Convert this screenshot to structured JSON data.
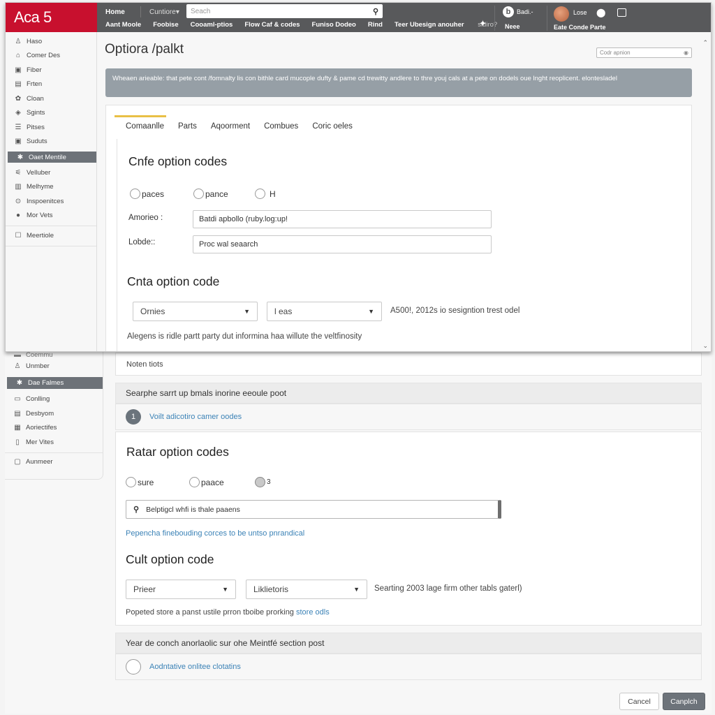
{
  "app": {
    "brand": "Aca 5",
    "brand_color": "#c8102e",
    "header_color": "#58595b"
  },
  "topnav": {
    "home": "Home",
    "customize": "Cuntiore",
    "search_placeholder": "Seach",
    "items": [
      "Aant Moole",
      "Foobise",
      "Cooaml-ptios",
      "Flow Caf & codes",
      "Funiso Dodeo",
      "Rind"
    ],
    "extra_text": "Teer Ubesign anouher",
    "extra_muted": "sidiro?",
    "user1": {
      "label": "Badi.-",
      "sub": "Neee"
    },
    "user2": {
      "label": "Lose",
      "sub": "Eate Conde Parte"
    }
  },
  "sidebar_top": {
    "items": [
      {
        "icon": "person-icon",
        "glyph": "♙",
        "label": "Haso"
      },
      {
        "icon": "building-icon",
        "glyph": "⌂",
        "label": "Comer Des"
      },
      {
        "icon": "inbox-icon",
        "glyph": "▣",
        "label": "Fiber"
      },
      {
        "icon": "document-icon",
        "glyph": "▤",
        "label": "Frten"
      },
      {
        "icon": "gear-icon",
        "glyph": "✿",
        "label": "Cloan"
      },
      {
        "icon": "tag-icon",
        "glyph": "◈",
        "label": "Sgints"
      },
      {
        "icon": "list-icon",
        "glyph": "☰",
        "label": "Pitses"
      },
      {
        "icon": "lock-icon",
        "glyph": "🔒",
        "label": "Suduts"
      }
    ],
    "active": {
      "icon": "badge-icon",
      "glyph": "✱",
      "label": "Oaet Mentile"
    },
    "items2": [
      {
        "icon": "filter-icon",
        "glyph": "⚟",
        "label": "Velluber"
      },
      {
        "icon": "chart-icon",
        "glyph": "▥",
        "label": "Melhyme"
      },
      {
        "icon": "info-icon",
        "glyph": "⊙",
        "label": "Inspoenitces"
      },
      {
        "icon": "pin-icon",
        "glyph": "●",
        "label": "Mor Vets"
      }
    ],
    "footer": {
      "icon": "checkbox-icon",
      "glyph": "☐",
      "label": "Meertiole"
    }
  },
  "page": {
    "title": "Optiora /palkt",
    "code_option_placeholder": "Codr apnion",
    "banner": "Wheaen arieable: that pete cont /fomnalty lis con bithle card mucople dufty & pame cd trewitty andlere to thre youj cals at a pete on dodels oue lnght reoplicent. elontesladel",
    "tabs": [
      "Comaanlle",
      "Parts",
      "Aqoorment",
      "Combues",
      "Coric oeles"
    ],
    "active_tab": 0
  },
  "section1": {
    "title": "Cnfe option codes",
    "radios": [
      "paces",
      "pance",
      "H"
    ],
    "fields": [
      {
        "label": "Amorieo :",
        "value": "Batdi apbollo (ruby.log:up!"
      },
      {
        "label": "Lobde::",
        "value": "Proc wal seaarch"
      }
    ]
  },
  "section2": {
    "title": "Cnta option code",
    "select1": "Ornies",
    "select2": "l eas",
    "info": "A500!, 2012s io sesigntion trest odel",
    "note": "Alegens is ridle partt party dut informina haa willute the veltfinosity"
  },
  "lower": {
    "notes_title": "Noten tiots",
    "panel1": {
      "header": "Searphe sarrt up bmals inorine eeoule poot",
      "step_number": "1",
      "link": "Voilt adicotiro camer oodes"
    },
    "section3": {
      "title": "Ratar option codes",
      "radios": [
        "sure",
        "paace",
        "3"
      ],
      "selected_radio": 2,
      "search_value": "Belptigcl whfi is thale paaens",
      "link_text": "Pepencha finebouding corces to be untso pnrandical"
    },
    "section4": {
      "title": "Cult option code",
      "select1": "Prieer",
      "select2": "Liklietoris",
      "info": "Searting 2003 lage firm other tabls gaterl)",
      "note": "Popeted store a panst ustile prron tboibe prorking",
      "note_link": "store odls"
    },
    "panel2": {
      "header": "Year de conch anorlaolic sur ohe Meintfé section post",
      "link": "Aodntative onlitee clotatins"
    },
    "buttons": {
      "cancel": "Cancel",
      "primary": "Canplch"
    }
  },
  "sidebar_bottom": {
    "partial": {
      "icon": "folder-icon",
      "glyph": "▬",
      "label": "Coemmu"
    },
    "items": [
      {
        "icon": "person-icon",
        "glyph": "♙",
        "label": "Unmber"
      }
    ],
    "active": {
      "icon": "badge-icon",
      "glyph": "✱",
      "label": "Dae Falmes"
    },
    "items2": [
      {
        "icon": "monitor-icon",
        "glyph": "▭",
        "label": "Conlling"
      },
      {
        "icon": "document-icon",
        "glyph": "▤",
        "label": "Desbyom"
      },
      {
        "icon": "grid-icon",
        "glyph": "▦",
        "label": "Aoriectifes"
      },
      {
        "icon": "clipboard-icon",
        "glyph": "▯",
        "label": "Mer Vites"
      }
    ],
    "footer": {
      "icon": "frame-icon",
      "glyph": "▢",
      "label": "Aunmeer"
    }
  }
}
